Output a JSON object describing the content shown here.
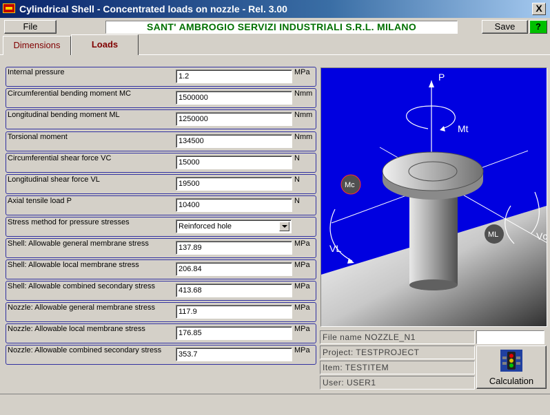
{
  "window": {
    "title": "Cylindrical Shell - Concentrated loads on nozzle -   Rel. 3.00",
    "close_label": "X"
  },
  "toolbar": {
    "file_label": "File",
    "company": "SANT' AMBROGIO SERVIZI INDUSTRIALI S.R.L.   MILANO",
    "save_label": "Save",
    "help_label": "?"
  },
  "tabs": [
    {
      "label": "Dimensions",
      "active": false
    },
    {
      "label": "Loads",
      "active": true
    }
  ],
  "fields": [
    {
      "label": "Internal pressure",
      "value": "1.2",
      "unit": "MPa"
    },
    {
      "label": "Circumferential bending moment MC",
      "value": "1500000",
      "unit": "Nmm"
    },
    {
      "label": "Longitudinal bending moment ML",
      "value": "1250000",
      "unit": "Nmm"
    },
    {
      "label": "Torsional moment",
      "value": "134500",
      "unit": "Nmm"
    },
    {
      "label": "Circumferential shear force VC",
      "value": "15000",
      "unit": "N"
    },
    {
      "label": "Longitudinal shear force VL",
      "value": "19500",
      "unit": "N"
    },
    {
      "label": "Axial tensile load P",
      "value": "10400",
      "unit": "N"
    },
    {
      "label": "Stress method for pressure stresses",
      "value": "Reinforced hole",
      "unit": ""
    },
    {
      "label": "Shell: Allowable general membrane stress",
      "value": "137.89",
      "unit": "MPa"
    },
    {
      "label": "Shell: Allowable local membrane stress",
      "value": "206.84",
      "unit": "MPa"
    },
    {
      "label": "Shell: Allowable combined secondary stress",
      "value": "413.68",
      "unit": "MPa"
    },
    {
      "label": "Nozzle: Allowable general membrane stress",
      "value": "117.9",
      "unit": "MPa"
    },
    {
      "label": "Nozzle: Allowable local membrane stress",
      "value": "176.85",
      "unit": "MPa"
    },
    {
      "label": "Nozzle: Allowable combined secondary stress",
      "value": "353.7",
      "unit": "MPa"
    }
  ],
  "diagram": {
    "labels": {
      "p": "P",
      "mt": "Mt",
      "mc": "Mc",
      "vl": "VL",
      "ml": "ML",
      "vc": "Vc"
    }
  },
  "info": {
    "file_name": "File name   NOZZLE_N1",
    "file_extra": "",
    "project": "Project:  TESTPROJECT",
    "item": "Item:  TESTITEM",
    "user": "User:   USER1"
  },
  "calc": {
    "label": "Calculation",
    "icon": "traffic-light-icon"
  },
  "colors": {
    "accent_blue": "#0000e0",
    "company_text": "#007000",
    "tab_text": "#800000",
    "help_green": "#00c000"
  }
}
